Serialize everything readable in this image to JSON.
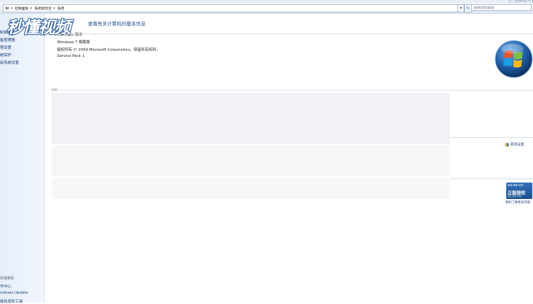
{
  "window": {
    "controls": [
      "–",
      "□",
      "×"
    ]
  },
  "address_bar": {
    "breadcrumbs": [
      "制",
      "控制面板",
      "系统和安全",
      "系统"
    ],
    "search_placeholder": "搜索控制面板"
  },
  "sidebar": {
    "items": [
      "制面板主页",
      "备管理器",
      "程设置",
      "统保护",
      "级系统设置"
    ],
    "see_also_header": "另请参阅",
    "see_also": [
      "作中心",
      "indows Update",
      "能信息和工具"
    ]
  },
  "watermark": {
    "text": "秒懂视频"
  },
  "main": {
    "title": "查看有关计算机的基本信息",
    "edition_header": "Windows 版本",
    "edition": "Windows 7 旗舰版",
    "copyright": "版权所有 © 2009 Microsoft Corporation。保留所有权利。",
    "service_pack": "Service Pack 1",
    "system_header": "系统",
    "change_settings": "更改设置"
  },
  "genuine": {
    "line1": "使用 微软 软件",
    "line2": "正版授权",
    "line3": "安全 稳定 声誉",
    "more": "联机了解更多内容"
  },
  "colors": {
    "link": "#1f3f7a",
    "title": "#1e4d8c",
    "sidebar_bg": "#e6eefa"
  }
}
